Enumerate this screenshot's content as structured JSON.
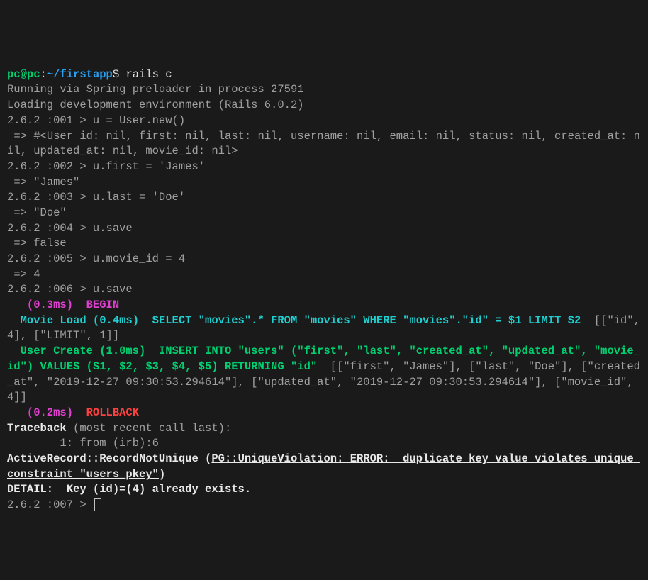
{
  "prompt": {
    "user": "pc@pc",
    "sep1": ":",
    "path": "~/firstapp",
    "sep2": "$ "
  },
  "cmd0": "rails c",
  "line1": "Running via Spring preloader in process 27591",
  "line2": "Loading development environment (Rails 6.0.2)",
  "p1": "2.6.2 :001 > ",
  "in1": "u = User.new()",
  "out1": " => #<User id: nil, first: nil, last: nil, username: nil, email: nil, status: nil, created_at: nil, updated_at: nil, movie_id: nil>",
  "p2": "2.6.2 :002 > ",
  "in2": "u.first = 'James'",
  "out2": " => \"James\"",
  "p3": "2.6.2 :003 > ",
  "in3": "u.last = 'Doe'",
  "out3": " => \"Doe\"",
  "p4": "2.6.2 :004 > ",
  "in4": "u.save",
  "out4": " => false",
  "p5": "2.6.2 :005 > ",
  "in5": "u.movie_id = 4",
  "out5": " => 4",
  "p6": "2.6.2 :006 > ",
  "in6": "u.save",
  "sql": {
    "t1": "   (0.3ms)  ",
    "begin": "BEGIN",
    "load1": "  Movie Load (0.4ms)  ",
    "sel1": "SELECT \"movies\".* FROM \"movies\" WHERE \"movies\".\"id\" = $1 LIMIT $2",
    "sel1b": "  [[\"id\", 4], [\"LIMIT\", 1]]",
    "create1": "  User Create (1.0ms)  ",
    "ins1": "INSERT INTO \"users\" (\"first\", \"last\", \"created_at\", \"updated_at\", \"movie_id\") VALUES ($1, $2, $3, $4, $5) RETURNING \"id\"",
    "ins1b": "  [[\"first\", \"James\"], [\"last\", \"Doe\"], [\"created_at\", \"2019-12-27 09:30:53.294614\"], [\"updated_at\", \"2019-12-27 09:30:53.294614\"], [\"movie_id\", 4]]",
    "t2": "   (0.2ms)  ",
    "rollback": "ROLLBACK"
  },
  "trace1a": "Traceback",
  "trace1b": " (most recent call last):",
  "trace2": "        1: from (irb):6",
  "err1a": "ActiveRecord::RecordNotUnique (",
  "err1b": "PG::UniqueViolation: ERROR:  duplicate key value violates unique constraint \"users_pkey\"",
  "err1c": ")",
  "detail": "DETAIL:  Key (id)=(4) already exists.",
  "p7": "2.6.2 :007 > "
}
